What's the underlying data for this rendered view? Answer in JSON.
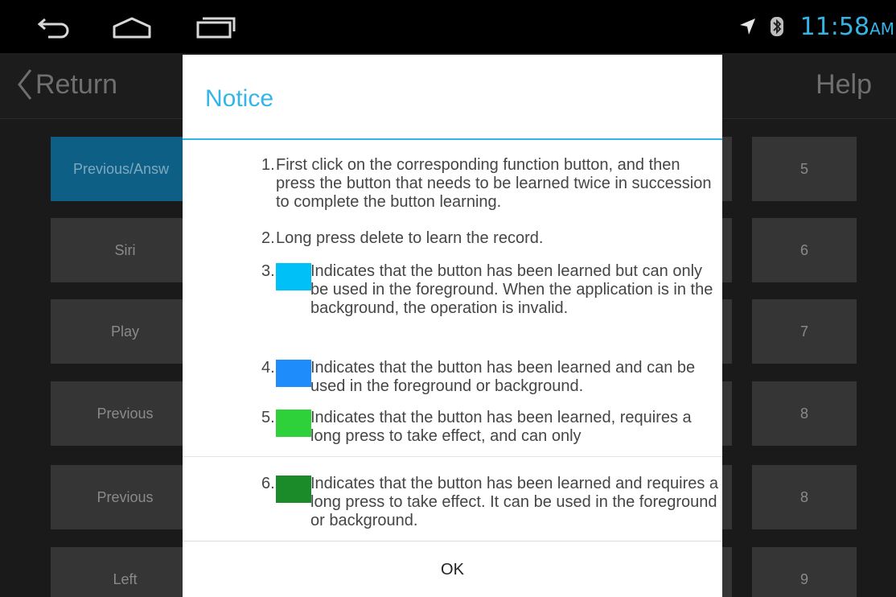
{
  "statusbar": {
    "nav": [
      {
        "name": "back-icon"
      },
      {
        "name": "home-icon"
      },
      {
        "name": "recent-apps-icon"
      }
    ],
    "icons": [
      "location-arrow-icon",
      "bluetooth-icon"
    ],
    "time": "11:58",
    "ampm": "AM",
    "accent_color": "#33b5e5"
  },
  "app": {
    "return_label": "Return",
    "help_label": "Help",
    "function_buttons": [
      {
        "label": "Previous/Answ",
        "active": true
      },
      {
        "label": "Siri"
      },
      {
        "label": "Play"
      },
      {
        "label": "Previous"
      },
      {
        "label": "Previous"
      },
      {
        "label": "Left"
      }
    ],
    "number_buttons": [
      "5",
      "6",
      "7",
      "8",
      "8",
      "9"
    ]
  },
  "dialog": {
    "title": "Notice",
    "items": [
      {
        "num": "1.",
        "text": "First click on the corresponding function button, and then press the button that needs to be learned twice in succession to complete the button learning."
      },
      {
        "num": "2.",
        "text": "Long press delete to learn the record."
      },
      {
        "num": "3.",
        "swatch": "#00c0f8",
        "text": "Indicates that the button has been learned but can only be used in the foreground. When the application is in the background, the operation is invalid."
      },
      {
        "num": "4.",
        "swatch": "#1e8cfa",
        "text": "Indicates that the button has been learned and can be used in the foreground or background."
      },
      {
        "num": "5.",
        "swatch": "#2ed13a",
        "text": "Indicates that the button has been learned, requires a long press to take effect, and can only"
      },
      {
        "num": "6.",
        "swatch": "#1b8a28",
        "text": "Indicates that the button has been learned and requires a long press to take effect. It can be used in the foreground or background."
      }
    ],
    "ok_label": "OK"
  }
}
